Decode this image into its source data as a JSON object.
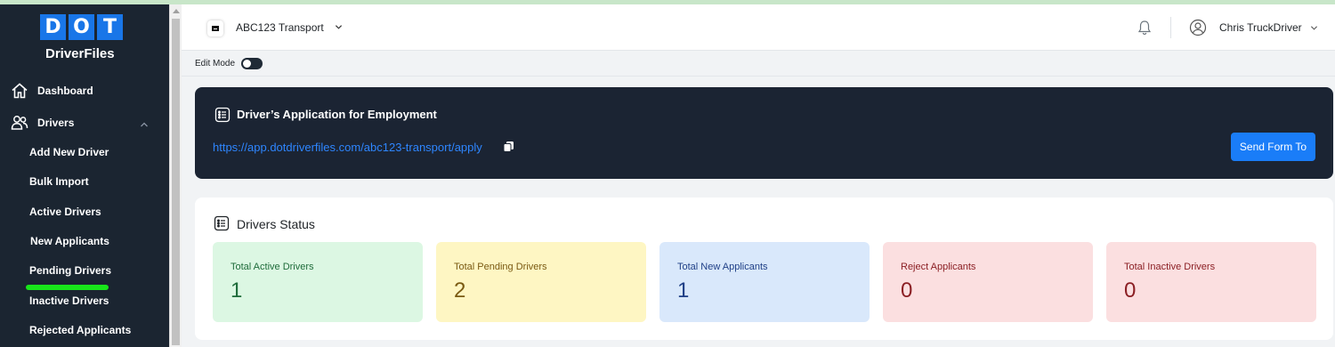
{
  "colors": {
    "sidebar_bg": "#1b2531",
    "logo_blue": "#1976e8",
    "active_underline": "#18e51a",
    "app_card_bg": "#1b2433",
    "link": "#2e86ff",
    "button": "#1a7df8"
  },
  "logo": {
    "letters": [
      "D",
      "O",
      "T"
    ],
    "subtitle": "DriverFiles"
  },
  "sidebar": {
    "dashboard": {
      "label": "Dashboard",
      "icon": "home-icon"
    },
    "drivers": {
      "label": "Drivers",
      "icon": "users-icon",
      "expanded": true
    },
    "sub_items": [
      {
        "label": "Add New Driver"
      },
      {
        "label": "Bulk Import"
      },
      {
        "label": "Active Drivers"
      },
      {
        "label": "New Applicants"
      },
      {
        "label": "Pending Drivers",
        "active": true
      },
      {
        "label": "Inactive Drivers"
      },
      {
        "label": "Rejected Applicants"
      }
    ]
  },
  "header": {
    "company": "ABC123 Transport",
    "user": "Chris TruckDriver"
  },
  "edit_mode": {
    "label": "Edit Mode",
    "enabled": false
  },
  "application": {
    "title": "Driver’s Application for Employment",
    "link": "https://app.dotdriverfiles.com/abc123-transport/apply",
    "send_button": "Send Form To"
  },
  "status": {
    "title": "Drivers Status",
    "cards": [
      {
        "label": "Total Active Drivers",
        "value": "1",
        "bg": "#dcf7e3",
        "fg": "#1e6b3a"
      },
      {
        "label": "Total Pending Drivers",
        "value": "2",
        "bg": "#fef6c3",
        "fg": "#7a5a12"
      },
      {
        "label": "Total New Applicants",
        "value": "1",
        "bg": "#d9e8fb",
        "fg": "#1f3f86"
      },
      {
        "label": "Reject Applicants",
        "value": "0",
        "bg": "#fbdfe0",
        "fg": "#8b1f24"
      },
      {
        "label": "Total Inactive Drivers",
        "value": "0",
        "bg": "#fbdfe0",
        "fg": "#8b1f24"
      }
    ]
  }
}
